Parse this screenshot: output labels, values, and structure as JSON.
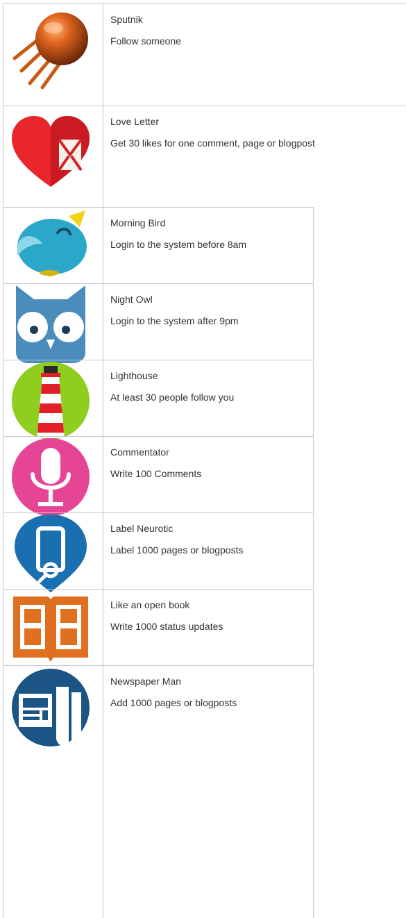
{
  "badges": [
    {
      "title": "Sputnik",
      "description": "Follow someone",
      "icon": "sputnik-icon"
    },
    {
      "title": "Love Letter",
      "description": "Get 30 likes for one comment, page or blogpost",
      "icon": "heart-letter-icon"
    },
    {
      "title": "Morning Bird",
      "description": "Login to the system before 8am",
      "icon": "bird-icon"
    },
    {
      "title": "Night Owl",
      "description": "Login to the system after 9pm",
      "icon": "owl-icon"
    },
    {
      "title": "Lighthouse",
      "description": "At least 30 people follow you",
      "icon": "lighthouse-icon"
    },
    {
      "title": "Commentator",
      "description": "Write 100 Comments",
      "icon": "microphone-icon"
    },
    {
      "title": "Label Neurotic",
      "description": "Label 1000 pages or blogposts",
      "icon": "tag-pin-icon"
    },
    {
      "title": "Like an open book",
      "description": "Write 1000 status updates",
      "icon": "open-book-icon"
    },
    {
      "title": "Newspaper Man",
      "description": "Add 1000 pages or blogposts",
      "icon": "newspaper-icon"
    }
  ],
  "colors": {
    "border": "#c1c7d0",
    "text": "#333333"
  }
}
